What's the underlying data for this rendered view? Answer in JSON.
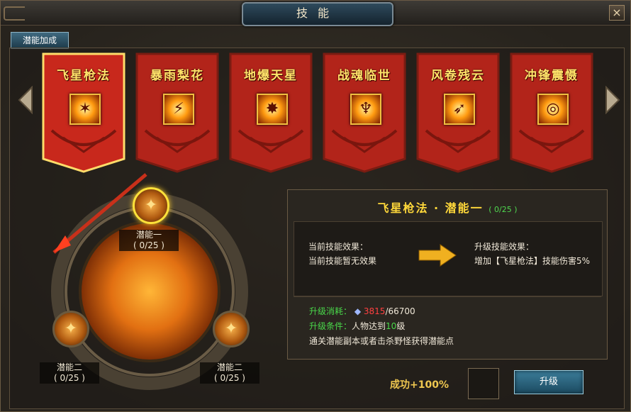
{
  "window": {
    "title": "技能",
    "close_label": "×"
  },
  "tabs": [
    {
      "label": "潜能加成"
    }
  ],
  "banners": [
    {
      "name": "飞星枪法",
      "icon": "spear-strike-icon",
      "selected": true
    },
    {
      "name": "暴雨梨花",
      "icon": "spear-storm-icon",
      "selected": false
    },
    {
      "name": "地爆天星",
      "icon": "ground-burst-icon",
      "selected": false
    },
    {
      "name": "战魂临世",
      "icon": "war-soul-icon",
      "selected": false
    },
    {
      "name": "风卷残云",
      "icon": "whirlwind-icon",
      "selected": false
    },
    {
      "name": "冲锋震慑",
      "icon": "charge-icon",
      "selected": false
    }
  ],
  "nodes": [
    {
      "label": "潜能一",
      "progress": "( 0/25 )"
    },
    {
      "label": "潜能二",
      "progress": "( 0/25 )"
    },
    {
      "label": "潜能二",
      "progress": "( 0/25 )"
    }
  ],
  "info": {
    "title": "飞星枪法 · 潜能一",
    "level": "( 0/25 )",
    "current_header": "当前技能效果：",
    "current_text": "当前技能暂无效果",
    "upgrade_header": "升级技能效果：",
    "upgrade_text": "增加【飞星枪法】技能伤害5%",
    "cost_label": "升级消耗：",
    "cost_have": "3815",
    "cost_need": "/66700",
    "cond_label": "升级条件：",
    "cond_text_a": "人物达到",
    "cond_level": "10",
    "cond_text_b": "级",
    "hint": "通关潜能副本或者击杀野怪获得潜能点"
  },
  "success_rate": "成功+100%",
  "upgrade_button": "升级",
  "colors": {
    "banner_red": "#b2241a",
    "gold": "#ffd83a",
    "green": "#49d84a",
    "red": "#ff4040"
  }
}
